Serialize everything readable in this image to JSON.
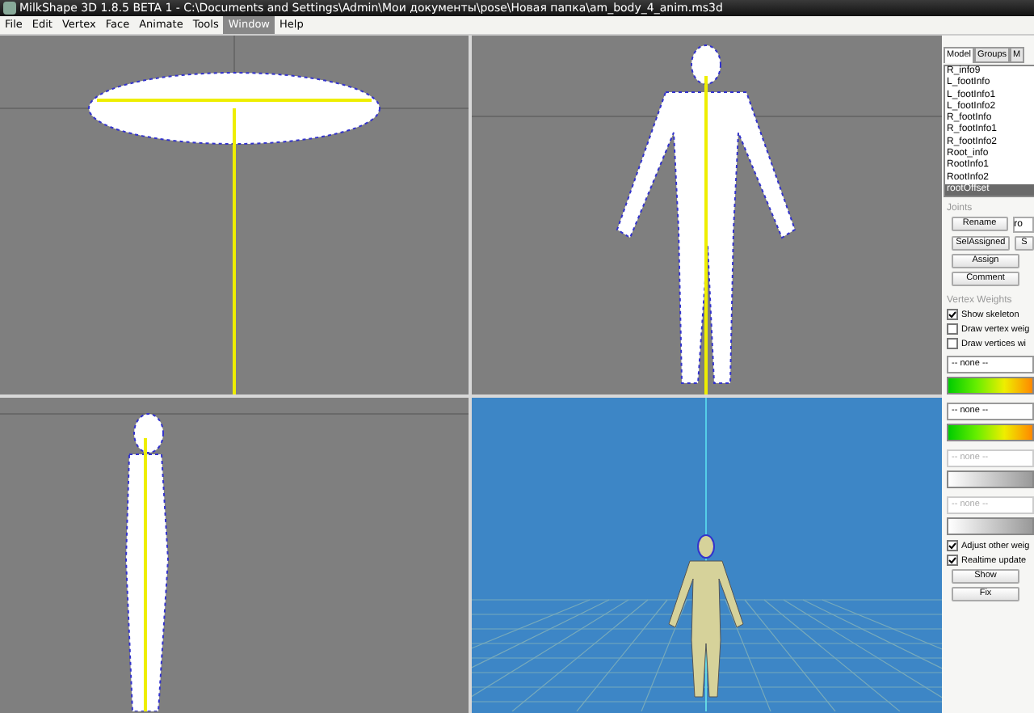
{
  "window": {
    "title": "MilkShape 3D 1.8.5 BETA 1 - C:\\Documents and Settings\\Admin\\Мои документы\\pose\\Новая папка\\am_body_4_anim.ms3d"
  },
  "menu": [
    {
      "label": "File",
      "selected": false
    },
    {
      "label": "Edit",
      "selected": false
    },
    {
      "label": "Vertex",
      "selected": false
    },
    {
      "label": "Face",
      "selected": false
    },
    {
      "label": "Animate",
      "selected": false
    },
    {
      "label": "Tools",
      "selected": false
    },
    {
      "label": "Window",
      "selected": true
    },
    {
      "label": "Help",
      "selected": false
    }
  ],
  "viewports": [
    {
      "kind": "top"
    },
    {
      "kind": "front"
    },
    {
      "kind": "side"
    },
    {
      "kind": "perspective"
    }
  ],
  "panel": {
    "tabs": [
      {
        "label": "Model",
        "selected": true
      },
      {
        "label": "Groups",
        "selected": false
      },
      {
        "label": "M",
        "selected": false
      }
    ],
    "joints_list": [
      {
        "label": "R_info9",
        "selected": false
      },
      {
        "label": "L_footInfo",
        "selected": false
      },
      {
        "label": "L_footInfo1",
        "selected": false
      },
      {
        "label": "L_footInfo2",
        "selected": false
      },
      {
        "label": "R_footInfo",
        "selected": false
      },
      {
        "label": "R_footInfo1",
        "selected": false
      },
      {
        "label": "R_footInfo2",
        "selected": false
      },
      {
        "label": "Root_info",
        "selected": false
      },
      {
        "label": "RootInfo1",
        "selected": false
      },
      {
        "label": "RootInfo2",
        "selected": false
      },
      {
        "label": "rootOffset",
        "selected": true
      }
    ],
    "joints": {
      "title": "Joints",
      "buttons": [
        "Rename",
        "SelAssigned",
        "Assign",
        "Comment"
      ],
      "name_field": "ro",
      "side_button": "S"
    },
    "vertex_weights": {
      "title": "Vertex Weights",
      "checks_top": [
        {
          "label": "Show skeleton",
          "checked": true
        },
        {
          "label": "Draw vertex weig",
          "checked": false
        },
        {
          "label": "Draw vertices wi",
          "checked": false
        }
      ],
      "weights": [
        {
          "value": "-- none --",
          "disabled": false,
          "kind": "color"
        },
        {
          "value": "-- none --",
          "disabled": false,
          "kind": "color"
        },
        {
          "value": "-- none --",
          "disabled": true,
          "kind": "gray"
        },
        {
          "value": "-- none --",
          "disabled": true,
          "kind": "gray"
        }
      ],
      "checks_bottom": [
        {
          "label": "Adjust other weig",
          "checked": true
        },
        {
          "label": "Realtime update",
          "checked": true
        }
      ],
      "buttons": [
        "Show",
        "Fix"
      ]
    }
  }
}
